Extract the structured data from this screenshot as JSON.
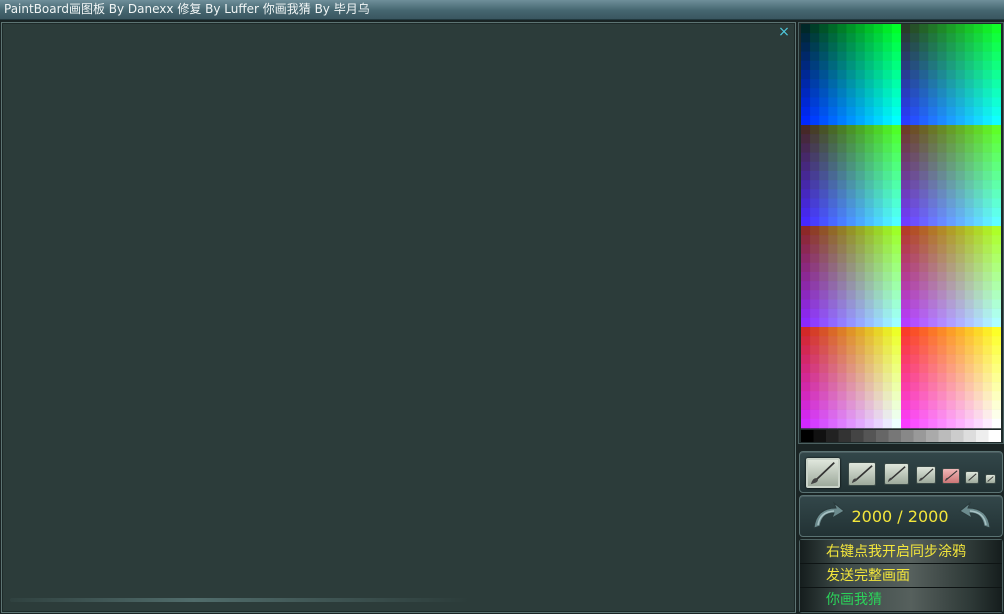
{
  "window": {
    "title": "PaintBoard画图板 By Danexx  修复 By Luffer  你画我猜 By 毕月乌"
  },
  "canvas": {
    "close_icon": "×"
  },
  "palette": {
    "grayscale_steps": 16
  },
  "brushes": [
    {
      "name": "brush-size-1",
      "selected": true
    },
    {
      "name": "brush-size-2",
      "selected": false
    },
    {
      "name": "brush-size-3",
      "selected": false
    },
    {
      "name": "brush-size-4",
      "selected": false
    },
    {
      "name": "eraser",
      "selected": false
    },
    {
      "name": "brush-size-5",
      "selected": false
    },
    {
      "name": "brush-size-6",
      "selected": false
    }
  ],
  "counter": {
    "text": "2000 / 2000",
    "current": 2000,
    "max": 2000
  },
  "menu": {
    "sync_doodle": "右键点我开启同步涂鸦",
    "send_full": "发送完整画面",
    "guess_game": "你画我猜"
  },
  "colors": {
    "canvas_bg": "#2c3c3a",
    "accent_yellow": "#f3e63b",
    "accent_green": "#2bd35a",
    "close_icon": "#4fc9dd"
  }
}
